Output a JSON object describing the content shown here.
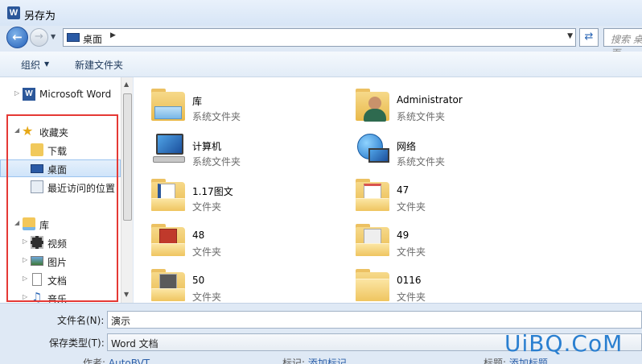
{
  "window": {
    "title": "另存为",
    "app_icon_letter": "W"
  },
  "nav": {
    "address": "桌面",
    "search_placeholder": "搜索 桌面"
  },
  "toolbar": {
    "organize": "组织",
    "new_folder": "新建文件夹"
  },
  "sidebar": {
    "items": [
      {
        "label": "Microsoft Word",
        "icon": "word-icon"
      },
      {
        "label": "收藏夹",
        "icon": "star-icon"
      },
      {
        "label": "下载",
        "icon": "download-folder-icon"
      },
      {
        "label": "桌面",
        "icon": "desktop-icon",
        "selected": true
      },
      {
        "label": "最近访问的位置",
        "icon": "recent-places-icon"
      },
      {
        "label": "库",
        "icon": "library-icon"
      },
      {
        "label": "视频",
        "icon": "video-icon"
      },
      {
        "label": "图片",
        "icon": "picture-icon"
      },
      {
        "label": "文档",
        "icon": "document-icon"
      },
      {
        "label": "音乐",
        "icon": "music-icon"
      }
    ]
  },
  "files": [
    {
      "name": "库",
      "type": "系统文件夹",
      "icon": "library-icon"
    },
    {
      "name": "Administrator",
      "type": "系统文件夹",
      "icon": "user-folder-icon"
    },
    {
      "name": "计算机",
      "type": "系统文件夹",
      "icon": "computer-icon"
    },
    {
      "name": "网络",
      "type": "系统文件夹",
      "icon": "network-icon"
    },
    {
      "name": "1.17图文",
      "type": "文件夹",
      "icon": "folder-icon"
    },
    {
      "name": "47",
      "type": "文件夹",
      "icon": "folder-icon"
    },
    {
      "name": "48",
      "type": "文件夹",
      "icon": "folder-icon"
    },
    {
      "name": "49",
      "type": "文件夹",
      "icon": "folder-icon"
    },
    {
      "name": "50",
      "type": "文件夹",
      "icon": "folder-icon"
    },
    {
      "name": "0116",
      "type": "文件夹",
      "icon": "folder-icon"
    }
  ],
  "form": {
    "filename_label": "文件名(N):",
    "filename_value": "演示",
    "filetype_label": "保存类型(T):",
    "filetype_value": "Word 文档"
  },
  "meta": {
    "author_label": "作者:",
    "author_value": "AutoBVT",
    "tags_label": "标记:",
    "tags_value": "添加标记",
    "title_label": "标题:",
    "title_value": "添加标题"
  },
  "watermark": "UiBQ.CoM"
}
